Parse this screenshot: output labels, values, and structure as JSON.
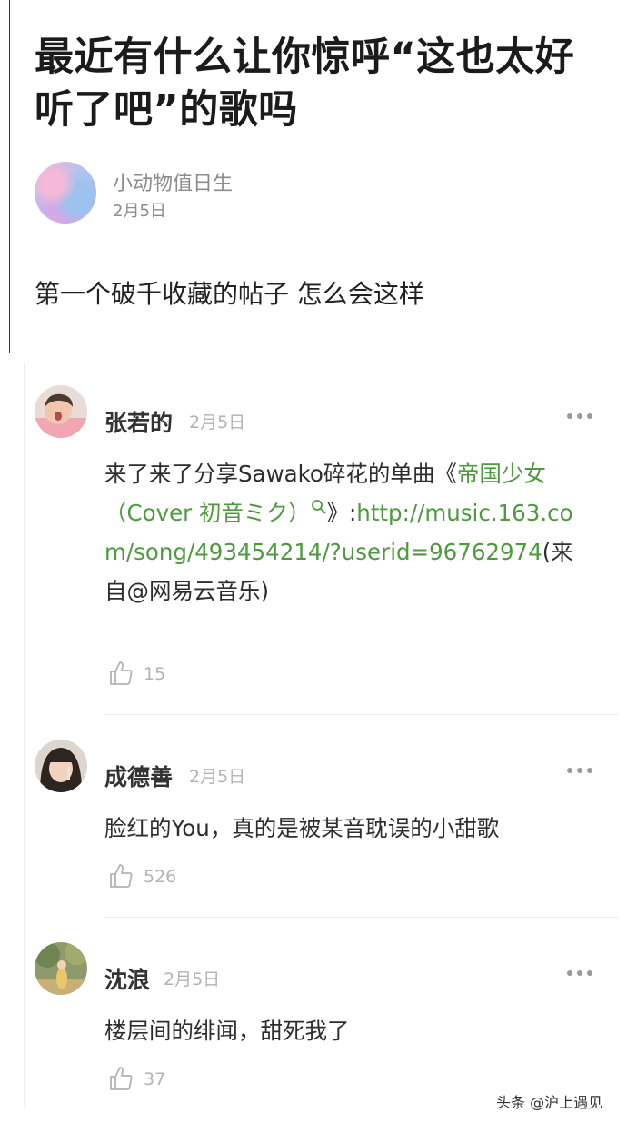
{
  "post": {
    "title": "最近有什么让你惊呼“这也太好听了吧”的歌吗",
    "author": {
      "name": "小动物值日生",
      "date": "2月5日"
    },
    "body": "第一个破千收藏的帖子 怎么会这样"
  },
  "comments": [
    {
      "name": "张若的",
      "date": "2月5日",
      "text_prefix": "来了来了分享Sawako碎花的单曲《",
      "song_link": "帝国少女（Cover 初音ミク）",
      "link_after": "》:",
      "url": "http://music.163.com/song/493454214/?userid=96762974",
      "text_suffix": "(来自@网易云音乐)",
      "likes": "15"
    },
    {
      "name": "成德善",
      "date": "2月5日",
      "text": "脸红的You，真的是被某音耽误的小甜歌",
      "likes": "526"
    },
    {
      "name": "沈浪",
      "date": "2月5日",
      "text": "楼层间的绯闻，甜死我了",
      "likes": "37"
    }
  ],
  "watermark": "头条 @沪上遇见",
  "icons": {
    "more": "more-dots-icon",
    "like": "thumbs-up-icon",
    "search": "search-icon"
  },
  "colors": {
    "link": "#4e9a3e",
    "meta": "#b3b3b3"
  }
}
